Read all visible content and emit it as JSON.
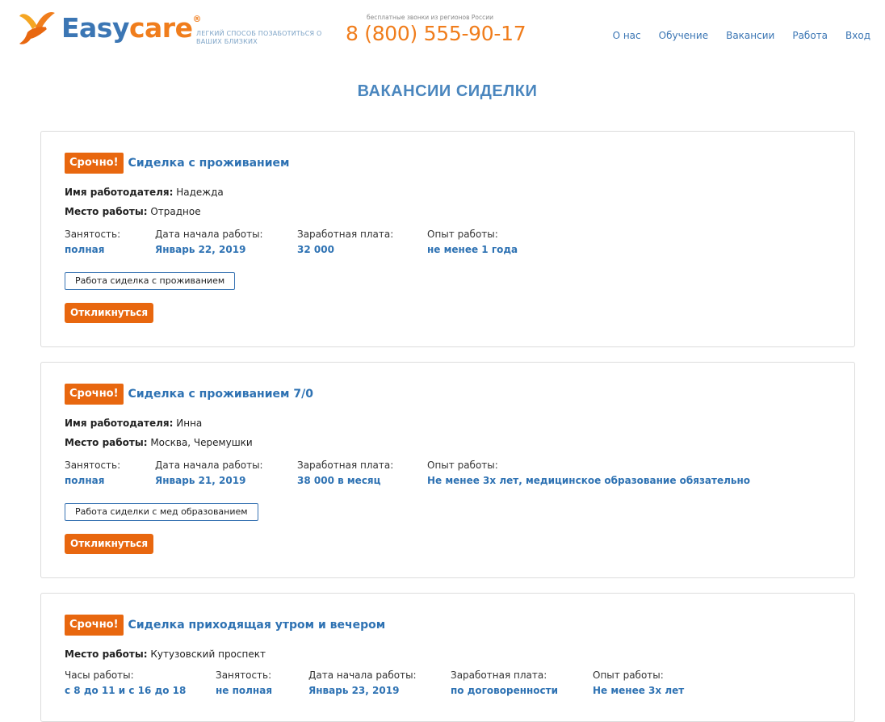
{
  "header": {
    "logo": {
      "easy": "Easy",
      "care": "care",
      "reg": "®"
    },
    "tagline": "ЛЕГКИЙ СПОСОБ ПОЗАБОТИТЬСЯ О ВАШИХ БЛИЗКИХ",
    "phone_note": "бесплатные звонки из регионов России",
    "phone": "8 (800) 555-90-17",
    "nav": [
      "О нас",
      "Обучение",
      "Вакансии",
      "Работа",
      "Вход"
    ]
  },
  "page_title": "ВАКАНСИИ СИДЕЛКИ",
  "vacancies": [
    {
      "badge": "Срочно!",
      "title": "Сиделка с проживанием",
      "employer_label": "Имя работодателя:",
      "employer": "Надежда",
      "place_label": "Место работы:",
      "place": "Отрадное",
      "details": [
        {
          "label": "Занятость:",
          "value": "полная"
        },
        {
          "label": "Дата начала работы:",
          "value": "Январь 22, 2019"
        },
        {
          "label": "Заработная плата:",
          "value": "32 000"
        },
        {
          "label": "Опыт работы:",
          "value": "не менее 1 года"
        }
      ],
      "tag": "Работа сиделка с проживанием",
      "respond": "Откликнуться"
    },
    {
      "badge": "Срочно!",
      "title": "Сиделка с проживанием 7/0",
      "employer_label": "Имя работодателя:",
      "employer": "Инна",
      "place_label": "Место работы:",
      "place": "Москва, Черемушки",
      "details": [
        {
          "label": "Занятость:",
          "value": "полная"
        },
        {
          "label": "Дата начала работы:",
          "value": "Январь 21, 2019"
        },
        {
          "label": "Заработная плата:",
          "value": "38 000 в месяц"
        },
        {
          "label": "Опыт работы:",
          "value": "Не менее 3х лет, медицинское образование обязательно"
        }
      ],
      "tag": "Работа сиделки с мед образованием",
      "respond": "Откликнуться"
    },
    {
      "badge": "Срочно!",
      "title": "Сиделка приходящая утром и вечером",
      "place_label": "Место работы:",
      "place": "Кутузовский проспект",
      "details": [
        {
          "label": "Часы работы:",
          "value": "с 8 до 11 и с 16 до 18"
        },
        {
          "label": "Занятость:",
          "value": "не полная"
        },
        {
          "label": "Дата начала работы:",
          "value": "Январь 23, 2019"
        },
        {
          "label": "Заработная плата:",
          "value": "по договоренности"
        },
        {
          "label": "Опыт работы:",
          "value": "Не менее 3х лет"
        }
      ]
    }
  ]
}
